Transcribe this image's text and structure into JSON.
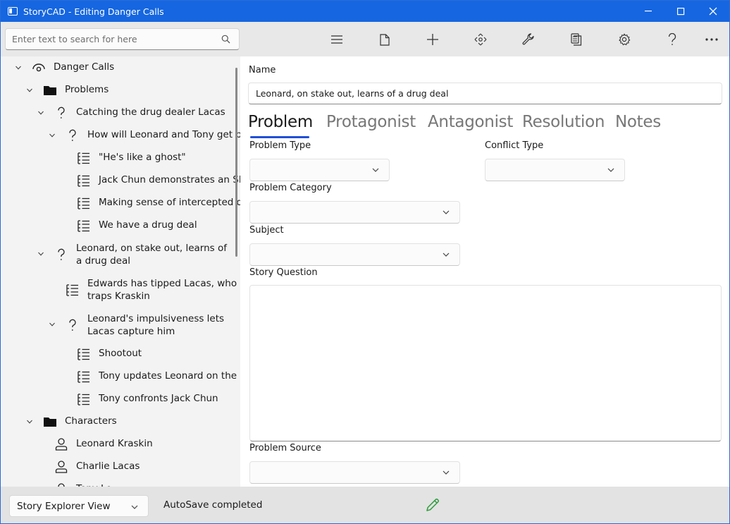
{
  "window": {
    "title": "StoryCAD - Editing Danger Calls",
    "controls": [
      "minimize",
      "maximize",
      "close"
    ]
  },
  "search": {
    "placeholder": "Enter text to search for here",
    "icon": "search-icon"
  },
  "toolbar": {
    "buttons": [
      {
        "name": "menu",
        "icon": "hamburger-icon"
      },
      {
        "name": "file",
        "icon": "document-icon"
      },
      {
        "name": "add",
        "icon": "plus-icon"
      },
      {
        "name": "move",
        "icon": "move-arrows-icon"
      },
      {
        "name": "tools",
        "icon": "wrench-icon"
      },
      {
        "name": "reports",
        "icon": "copy-icon"
      },
      {
        "name": "preferences",
        "icon": "gear-icon"
      },
      {
        "name": "help",
        "icon": "help-icon"
      },
      {
        "name": "more",
        "icon": "more-icon"
      }
    ]
  },
  "tree": {
    "items": [
      {
        "label": "Danger Calls",
        "type": "story",
        "expander": "expanded"
      },
      {
        "label": "Problems",
        "type": "folder",
        "expander": "expanded"
      },
      {
        "label": "Catching the drug dealer Lacas",
        "type": "problem",
        "expander": "expanded"
      },
      {
        "label": "How will Leonard and Tony get pas",
        "type": "problem",
        "expander": "expanded"
      },
      {
        "label": "\"He's like a ghost\"",
        "type": "scene"
      },
      {
        "label": "Jack Chun demonstrates an SDR",
        "type": "scene"
      },
      {
        "label": "Making sense of intercepted dat",
        "type": "scene"
      },
      {
        "label": "We have a drug deal",
        "type": "scene"
      },
      {
        "label": "Leonard, on stake out, learns of a drug deal",
        "type": "problem",
        "expander": "expanded"
      },
      {
        "label": "Edwards has tipped Lacas, who traps Kraskin",
        "type": "scene"
      },
      {
        "label": "Leonard's impulsiveness lets Lacas capture him",
        "type": "problem",
        "expander": "expanded"
      },
      {
        "label": "Shootout",
        "type": "scene"
      },
      {
        "label": "Tony updates Leonard on the at",
        "type": "scene"
      },
      {
        "label": "Tony confronts Jack Chun",
        "type": "scene"
      },
      {
        "label": "Characters",
        "type": "folder",
        "expander": "expanded"
      },
      {
        "label": "Leonard Kraskin",
        "type": "character"
      },
      {
        "label": "Charlie Lacas",
        "type": "character"
      },
      {
        "label": "Tony Lo",
        "type": "character"
      }
    ]
  },
  "form": {
    "name_label": "Name",
    "name_value": "Leonard, on stake out, learns of a drug deal",
    "tabs": [
      "Problem",
      "Protagonist",
      "Antagonist",
      "Resolution",
      "Notes"
    ],
    "active_tab": "Problem",
    "problem_type_label": "Problem Type",
    "conflict_type_label": "Conflict Type",
    "problem_category_label": "Problem Category",
    "subject_label": "Subject",
    "story_question_label": "Story Question",
    "problem_source_label": "Problem Source",
    "problem_type_value": "",
    "conflict_type_value": "",
    "problem_category_value": "",
    "subject_value": "",
    "story_question_value": "",
    "problem_source_value": ""
  },
  "status": {
    "view_selected": "Story Explorer View",
    "message": "AutoSave completed",
    "edit_icon": "pencil-icon"
  },
  "colors": {
    "titlebar": "#1566e0",
    "tab_indicator": "#1f4fd8",
    "pencil": "#2e9e3e"
  }
}
